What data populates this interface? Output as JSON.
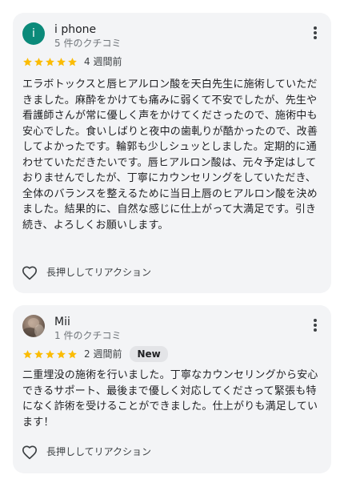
{
  "reviews": [
    {
      "author": "i phone",
      "avatar_letter": "i",
      "avatar_color": "#0b8a7a",
      "review_count": "5 件のクチコミ",
      "rating": 5,
      "time_ago": "4 週間前",
      "badge": "",
      "text": "エラボトックスと唇ヒアルロン酸を天白先生に施術していただきました。麻酔をかけても痛みに弱くて不安でしたが、先生や看護師さんが常に優しく声をかけてくださったので、施術中も安心でした。食いしばりと夜中の歯軋りが酷かったので、改善してよかったです。輪郭も少しシュッとしました。定期的に通わせていただきたいです。唇ヒアルロン酸は、元々予定はしておりませんでしたが、丁寧にカウンセリングをしていただき、全体のバランスを整えるために当日上唇のヒアルロン酸を決めました。結果的に、自然な感じに仕上がって大満足です。引き続き、よろしくお願いします。",
      "reaction_label": "長押ししてリアクション"
    },
    {
      "author": "Mii",
      "avatar_letter": "",
      "review_count": "1 件のクチコミ",
      "rating": 5,
      "time_ago": "2 週間前",
      "badge": "New",
      "text": "二重埋没の施術を行いました。丁寧なカウンセリングから安心できるサポート、最後まで優しく対応してくださって緊張も特になく詐術を受けることができました。仕上がりも満足しています！",
      "reaction_label": "長押ししてリアクション"
    }
  ],
  "colors": {
    "card_bg": "#f3f4f6",
    "star": "#fbbc04",
    "text": "#202124",
    "secondary_text": "#70757a"
  },
  "icons": {
    "more": "more-vert-icon",
    "star": "star-icon",
    "reaction": "heart-outline-icon"
  }
}
